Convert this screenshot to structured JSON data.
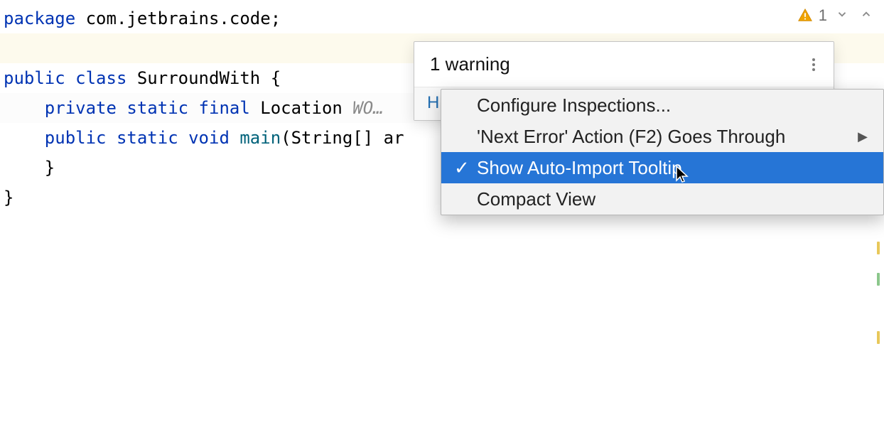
{
  "code": {
    "line1": {
      "kw_package": "package ",
      "pkg_name": "com.jetbrains.code",
      "semicolon": ";"
    },
    "line4": {
      "kw_public": "public ",
      "kw_class": "class ",
      "class_name": "SurroundWith ",
      "open_brace": "{"
    },
    "line5": {
      "indent": "    ",
      "kw_private": "private ",
      "kw_static": "static ",
      "kw_final": "final ",
      "type": "Location ",
      "var_hint": "WO…"
    },
    "line7": {
      "indent": "    ",
      "kw_public": "public ",
      "kw_static": "static ",
      "kw_void": "void ",
      "method_name": "main",
      "paren_open": "(",
      "param_type": "String[] ",
      "param_name": "ar"
    },
    "line9": {
      "indent": "    ",
      "close_brace": "}"
    },
    "line10": {
      "close_brace": "}"
    }
  },
  "inspection": {
    "warning_count": "1"
  },
  "popup": {
    "title": "1 warning",
    "link_highlight": "H"
  },
  "menu": {
    "configure": "Configure Inspections...",
    "next_error": "'Next Error' Action (F2) Goes Through",
    "auto_import": "Show Auto-Import Tooltip",
    "compact": "Compact View",
    "checkmark": "✓",
    "arrow": "▶"
  }
}
